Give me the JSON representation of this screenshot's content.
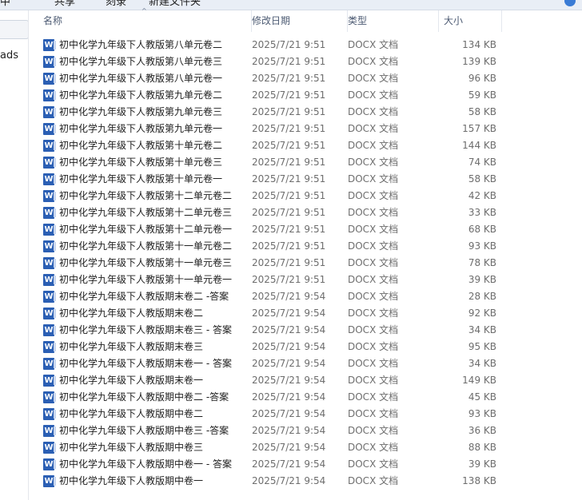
{
  "toolbar": {
    "items": [
      "中",
      "共享",
      "刻录",
      "新建文件夹"
    ]
  },
  "nav": {
    "items": [
      "",
      "ads"
    ]
  },
  "columns": {
    "name": "名称",
    "date": "修改日期",
    "type": "类型",
    "size": "大小"
  },
  "file_icon": "word-doc-icon",
  "colors": {
    "icon": "#2b5fb4",
    "header_text": "#4d5b73"
  },
  "files": [
    {
      "name": "初中化学九年级下人教版第八单元卷二",
      "date": "2025/7/21 9:51",
      "type": "DOCX 文档",
      "size": "134 KB"
    },
    {
      "name": "初中化学九年级下人教版第八单元卷三",
      "date": "2025/7/21 9:51",
      "type": "DOCX 文档",
      "size": "139 KB"
    },
    {
      "name": "初中化学九年级下人教版第八单元卷一",
      "date": "2025/7/21 9:51",
      "type": "DOCX 文档",
      "size": "96 KB"
    },
    {
      "name": "初中化学九年级下人教版第九单元卷二",
      "date": "2025/7/21 9:51",
      "type": "DOCX 文档",
      "size": "59 KB"
    },
    {
      "name": "初中化学九年级下人教版第九单元卷三",
      "date": "2025/7/21 9:51",
      "type": "DOCX 文档",
      "size": "58 KB"
    },
    {
      "name": "初中化学九年级下人教版第九单元卷一",
      "date": "2025/7/21 9:51",
      "type": "DOCX 文档",
      "size": "157 KB"
    },
    {
      "name": "初中化学九年级下人教版第十单元卷二",
      "date": "2025/7/21 9:51",
      "type": "DOCX 文档",
      "size": "144 KB"
    },
    {
      "name": "初中化学九年级下人教版第十单元卷三",
      "date": "2025/7/21 9:51",
      "type": "DOCX 文档",
      "size": "74 KB"
    },
    {
      "name": "初中化学九年级下人教版第十单元卷一",
      "date": "2025/7/21 9:51",
      "type": "DOCX 文档",
      "size": "58 KB"
    },
    {
      "name": "初中化学九年级下人教版第十二单元卷二",
      "date": "2025/7/21 9:51",
      "type": "DOCX 文档",
      "size": "42 KB"
    },
    {
      "name": "初中化学九年级下人教版第十二单元卷三",
      "date": "2025/7/21 9:51",
      "type": "DOCX 文档",
      "size": "33 KB"
    },
    {
      "name": "初中化学九年级下人教版第十二单元卷一",
      "date": "2025/7/21 9:51",
      "type": "DOCX 文档",
      "size": "68 KB"
    },
    {
      "name": "初中化学九年级下人教版第十一单元卷二",
      "date": "2025/7/21 9:51",
      "type": "DOCX 文档",
      "size": "93 KB"
    },
    {
      "name": "初中化学九年级下人教版第十一单元卷三",
      "date": "2025/7/21 9:51",
      "type": "DOCX 文档",
      "size": "78 KB"
    },
    {
      "name": "初中化学九年级下人教版第十一单元卷一",
      "date": "2025/7/21 9:51",
      "type": "DOCX 文档",
      "size": "39 KB"
    },
    {
      "name": "初中化学九年级下人教版期末卷二 -答案",
      "date": "2025/7/21 9:54",
      "type": "DOCX 文档",
      "size": "28 KB"
    },
    {
      "name": "初中化学九年级下人教版期末卷二",
      "date": "2025/7/21 9:54",
      "type": "DOCX 文档",
      "size": "92 KB"
    },
    {
      "name": "初中化学九年级下人教版期末卷三 - 答案",
      "date": "2025/7/21 9:54",
      "type": "DOCX 文档",
      "size": "34 KB"
    },
    {
      "name": "初中化学九年级下人教版期末卷三",
      "date": "2025/7/21 9:54",
      "type": "DOCX 文档",
      "size": "95 KB"
    },
    {
      "name": "初中化学九年级下人教版期末卷一 - 答案",
      "date": "2025/7/21 9:54",
      "type": "DOCX 文档",
      "size": "34 KB"
    },
    {
      "name": "初中化学九年级下人教版期末卷一",
      "date": "2025/7/21 9:54",
      "type": "DOCX 文档",
      "size": "149 KB"
    },
    {
      "name": "初中化学九年级下人教版期中卷二 -答案",
      "date": "2025/7/21 9:54",
      "type": "DOCX 文档",
      "size": "45 KB"
    },
    {
      "name": "初中化学九年级下人教版期中卷二",
      "date": "2025/7/21 9:54",
      "type": "DOCX 文档",
      "size": "93 KB"
    },
    {
      "name": "初中化学九年级下人教版期中卷三 -答案",
      "date": "2025/7/21 9:54",
      "type": "DOCX 文档",
      "size": "36 KB"
    },
    {
      "name": "初中化学九年级下人教版期中卷三",
      "date": "2025/7/21 9:54",
      "type": "DOCX 文档",
      "size": "88 KB"
    },
    {
      "name": "初中化学九年级下人教版期中卷一 - 答案",
      "date": "2025/7/21 9:54",
      "type": "DOCX 文档",
      "size": "39 KB"
    },
    {
      "name": "初中化学九年级下人教版期中卷一",
      "date": "2025/7/21 9:54",
      "type": "DOCX 文档",
      "size": "138 KB"
    }
  ]
}
